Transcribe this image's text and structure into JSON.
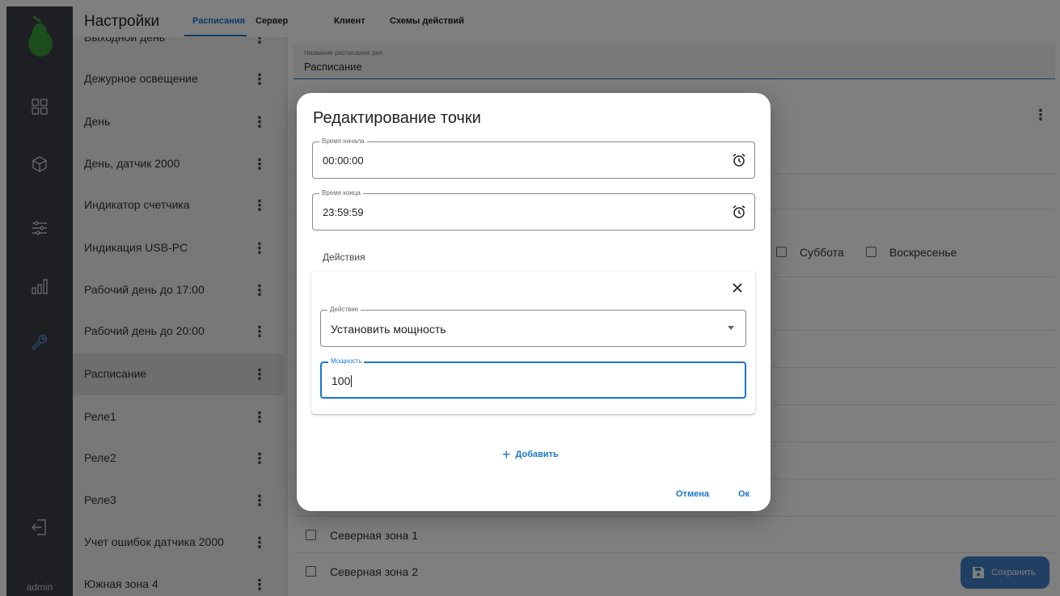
{
  "header": {
    "title": "Настройки",
    "tabs": [
      "Расписания",
      "Сервер",
      "Клиент",
      "Схемы действий"
    ]
  },
  "sidebar": {
    "user": "admin",
    "icons": [
      "pear-logo",
      "dashboard-icon",
      "cube-icon",
      "sliders-icon",
      "chart-icon",
      "wrench-icon",
      "logout-icon"
    ]
  },
  "schedules": {
    "items": [
      {
        "label": "Выходной день"
      },
      {
        "label": "Дежурное освещение"
      },
      {
        "label": "День"
      },
      {
        "label": "День, датчик 2000"
      },
      {
        "label": "Индикатор счетчика"
      },
      {
        "label": "Индикация USB-PC"
      },
      {
        "label": "Рабочий день до 17:00"
      },
      {
        "label": "Рабочий день до 20:00"
      },
      {
        "label": "Расписание"
      },
      {
        "label": "Реле1"
      },
      {
        "label": "Реле2"
      },
      {
        "label": "Реле3"
      },
      {
        "label": "Учет ошибок датчика 2000"
      },
      {
        "label": "Южная зона 4"
      }
    ],
    "selected": "Расписание"
  },
  "main": {
    "name_label": "Название расписания дня",
    "name_value": "Расписание",
    "days": [
      "Суббота",
      "Воскресенье"
    ],
    "zones": [
      "Северная зона 1",
      "Северная зона 2"
    ],
    "save_label": "Сохранить"
  },
  "dialog": {
    "title": "Редактирование точки",
    "start_label": "Время начала",
    "start_value": "00:00:00",
    "end_label": "Время конца",
    "end_value": "23:59:59",
    "actions_label": "Действия",
    "action_label": "Действие",
    "action_value": "Установить мощность",
    "power_label": "Мощность",
    "power_value": "100",
    "add_label": "Добавить",
    "cancel_label": "Отмена",
    "ok_label": "Ок"
  },
  "colors": {
    "accent": "#1976d2",
    "rail": "#3b3f44",
    "save_button": "#3f7ec7"
  }
}
